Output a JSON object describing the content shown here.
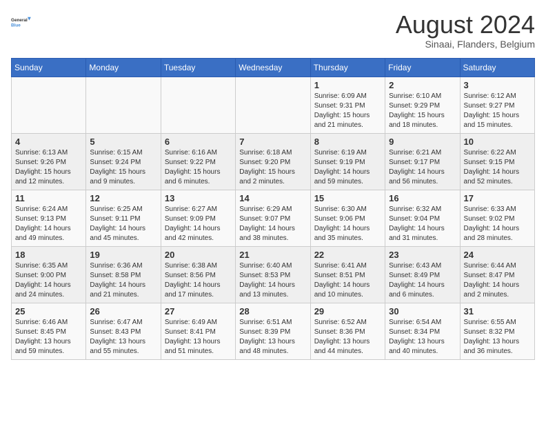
{
  "header": {
    "logo_line1": "General",
    "logo_line2": "Blue",
    "month": "August 2024",
    "location": "Sinaai, Flanders, Belgium"
  },
  "weekdays": [
    "Sunday",
    "Monday",
    "Tuesday",
    "Wednesday",
    "Thursday",
    "Friday",
    "Saturday"
  ],
  "weeks": [
    [
      {
        "day": "",
        "info": ""
      },
      {
        "day": "",
        "info": ""
      },
      {
        "day": "",
        "info": ""
      },
      {
        "day": "",
        "info": ""
      },
      {
        "day": "1",
        "info": "Sunrise: 6:09 AM\nSunset: 9:31 PM\nDaylight: 15 hours\nand 21 minutes."
      },
      {
        "day": "2",
        "info": "Sunrise: 6:10 AM\nSunset: 9:29 PM\nDaylight: 15 hours\nand 18 minutes."
      },
      {
        "day": "3",
        "info": "Sunrise: 6:12 AM\nSunset: 9:27 PM\nDaylight: 15 hours\nand 15 minutes."
      }
    ],
    [
      {
        "day": "4",
        "info": "Sunrise: 6:13 AM\nSunset: 9:26 PM\nDaylight: 15 hours\nand 12 minutes."
      },
      {
        "day": "5",
        "info": "Sunrise: 6:15 AM\nSunset: 9:24 PM\nDaylight: 15 hours\nand 9 minutes."
      },
      {
        "day": "6",
        "info": "Sunrise: 6:16 AM\nSunset: 9:22 PM\nDaylight: 15 hours\nand 6 minutes."
      },
      {
        "day": "7",
        "info": "Sunrise: 6:18 AM\nSunset: 9:20 PM\nDaylight: 15 hours\nand 2 minutes."
      },
      {
        "day": "8",
        "info": "Sunrise: 6:19 AM\nSunset: 9:19 PM\nDaylight: 14 hours\nand 59 minutes."
      },
      {
        "day": "9",
        "info": "Sunrise: 6:21 AM\nSunset: 9:17 PM\nDaylight: 14 hours\nand 56 minutes."
      },
      {
        "day": "10",
        "info": "Sunrise: 6:22 AM\nSunset: 9:15 PM\nDaylight: 14 hours\nand 52 minutes."
      }
    ],
    [
      {
        "day": "11",
        "info": "Sunrise: 6:24 AM\nSunset: 9:13 PM\nDaylight: 14 hours\nand 49 minutes."
      },
      {
        "day": "12",
        "info": "Sunrise: 6:25 AM\nSunset: 9:11 PM\nDaylight: 14 hours\nand 45 minutes."
      },
      {
        "day": "13",
        "info": "Sunrise: 6:27 AM\nSunset: 9:09 PM\nDaylight: 14 hours\nand 42 minutes."
      },
      {
        "day": "14",
        "info": "Sunrise: 6:29 AM\nSunset: 9:07 PM\nDaylight: 14 hours\nand 38 minutes."
      },
      {
        "day": "15",
        "info": "Sunrise: 6:30 AM\nSunset: 9:06 PM\nDaylight: 14 hours\nand 35 minutes."
      },
      {
        "day": "16",
        "info": "Sunrise: 6:32 AM\nSunset: 9:04 PM\nDaylight: 14 hours\nand 31 minutes."
      },
      {
        "day": "17",
        "info": "Sunrise: 6:33 AM\nSunset: 9:02 PM\nDaylight: 14 hours\nand 28 minutes."
      }
    ],
    [
      {
        "day": "18",
        "info": "Sunrise: 6:35 AM\nSunset: 9:00 PM\nDaylight: 14 hours\nand 24 minutes."
      },
      {
        "day": "19",
        "info": "Sunrise: 6:36 AM\nSunset: 8:58 PM\nDaylight: 14 hours\nand 21 minutes."
      },
      {
        "day": "20",
        "info": "Sunrise: 6:38 AM\nSunset: 8:56 PM\nDaylight: 14 hours\nand 17 minutes."
      },
      {
        "day": "21",
        "info": "Sunrise: 6:40 AM\nSunset: 8:53 PM\nDaylight: 14 hours\nand 13 minutes."
      },
      {
        "day": "22",
        "info": "Sunrise: 6:41 AM\nSunset: 8:51 PM\nDaylight: 14 hours\nand 10 minutes."
      },
      {
        "day": "23",
        "info": "Sunrise: 6:43 AM\nSunset: 8:49 PM\nDaylight: 14 hours\nand 6 minutes."
      },
      {
        "day": "24",
        "info": "Sunrise: 6:44 AM\nSunset: 8:47 PM\nDaylight: 14 hours\nand 2 minutes."
      }
    ],
    [
      {
        "day": "25",
        "info": "Sunrise: 6:46 AM\nSunset: 8:45 PM\nDaylight: 13 hours\nand 59 minutes."
      },
      {
        "day": "26",
        "info": "Sunrise: 6:47 AM\nSunset: 8:43 PM\nDaylight: 13 hours\nand 55 minutes."
      },
      {
        "day": "27",
        "info": "Sunrise: 6:49 AM\nSunset: 8:41 PM\nDaylight: 13 hours\nand 51 minutes."
      },
      {
        "day": "28",
        "info": "Sunrise: 6:51 AM\nSunset: 8:39 PM\nDaylight: 13 hours\nand 48 minutes."
      },
      {
        "day": "29",
        "info": "Sunrise: 6:52 AM\nSunset: 8:36 PM\nDaylight: 13 hours\nand 44 minutes."
      },
      {
        "day": "30",
        "info": "Sunrise: 6:54 AM\nSunset: 8:34 PM\nDaylight: 13 hours\nand 40 minutes."
      },
      {
        "day": "31",
        "info": "Sunrise: 6:55 AM\nSunset: 8:32 PM\nDaylight: 13 hours\nand 36 minutes."
      }
    ]
  ]
}
